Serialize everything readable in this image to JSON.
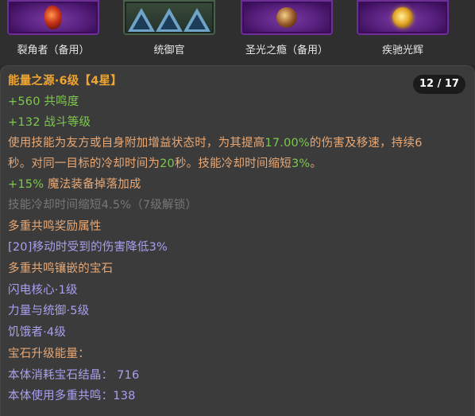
{
  "slots": [
    {
      "label": "裂角者（备用）",
      "icon": "red-horn-gem-icon"
    },
    {
      "label": "统御官",
      "icon": "blue-triangles-icon"
    },
    {
      "label": "圣光之瘾（备用）",
      "icon": "bronze-gem-icon"
    },
    {
      "label": "疾驰光辉",
      "icon": "gold-gem-icon"
    }
  ],
  "tooltip": {
    "title": "能量之源·6级【4星】",
    "page": "12 / 17",
    "stat1": "+560 共鸣度",
    "stat2": "+132 战斗等级",
    "desc": {
      "p1": "使用技能为友方或自身附加增益状态时，为其提高",
      "v1": "17.00%",
      "p2": "的伤害及移速，持续6",
      "p3": "秒。对同一目标的冷却时间为",
      "v2": "20",
      "p4": "秒。技能冷却时间缩短",
      "v3": "3%",
      "p5": "。"
    },
    "bonus_value": "+15%",
    "bonus_text": " 魔法装备掉落加成",
    "locked": "技能冷却时间缩短4.5%（7级解锁）",
    "multi_header": "多重共鸣奖励属性",
    "multi_bonus": "[20]移动时受到的伤害降低3%",
    "gems_header": "多重共鸣镶嵌的宝石",
    "gems": [
      "闪电核心·1级",
      "力量与统御·5级",
      "饥饿者·4级"
    ],
    "upgrade_header": "宝石升级能量：",
    "upgrade_lines": [
      "本体消耗宝石结晶： 716",
      "本体使用多重共鸣：138"
    ]
  },
  "colors": {
    "title": "#f0a531",
    "stat_green": "#7ec84e",
    "desc_orange": "#e9a874",
    "locked_grey": "#777777",
    "gem_blue": "#a8a0f0"
  }
}
